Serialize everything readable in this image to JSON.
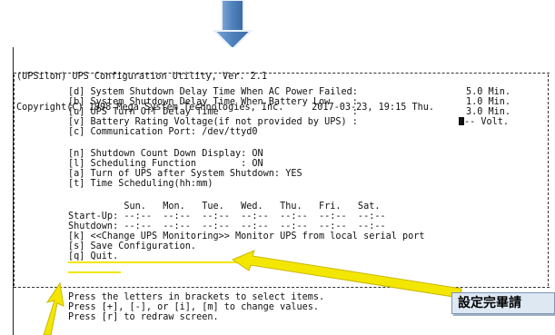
{
  "header": {
    "title_line": "(UPSilon) UPS Configuration Utility, Ver. 2.1",
    "copyright_line": "Copyright(C) 1998 Mega System Technologies, Inc.     2017-03-23, 19:15 Thu."
  },
  "settings": [
    {
      "label": "[d] System Shutdown Delay Time When AC Power Failed:",
      "value": "5.0 Min."
    },
    {
      "label": "[b] System Shutdown Delay Time When Battery Low    :",
      "value": "1.0 Min."
    },
    {
      "label": "[u] UPS Turn Off Delay Time                        :",
      "value": "3.0 Min."
    },
    {
      "label": "[v] Battery Rating Voltage(if not provided by UPS) :",
      "value": "-- Volt."
    },
    {
      "label": "[c] Communication Port: /dev/ttyd0",
      "value": ""
    }
  ],
  "options": [
    "[n] Shutdown Count Down Display: ON",
    "[l] Scheduling Function        : ON",
    "[a] Turn of UPS after System Shutdown: YES",
    "[t] Time Scheduling(hh:mm)"
  ],
  "schedule": {
    "days_header": "          Sun.   Mon.   Tue.   Wed.   Thu.   Fri.   Sat.",
    "startup_row": "Start-Up: --:--  --:--  --:--  --:--  --:--  --:--  --:--",
    "shutdown_row": "Shutdown: --:--  --:--  --:--  --:--  --:--  --:--  --:--"
  },
  "actions": {
    "monitor": "[k] <<Change UPS Monitoring>> Monitor UPS from local serial port",
    "save": "[s] Save Configuration.",
    "quit": "[q] Quit."
  },
  "help": [
    "Press the letters in brackets to select items.",
    "Press [+], [-], or [i], [m] to change values.",
    "Press [r] to redraw screen."
  ],
  "callout_text": "設定完畢請",
  "colors": {
    "arrow_blue": "#4f81bd",
    "highlight_yellow": "#f3e600",
    "callout_bg": "#dde8f3"
  }
}
